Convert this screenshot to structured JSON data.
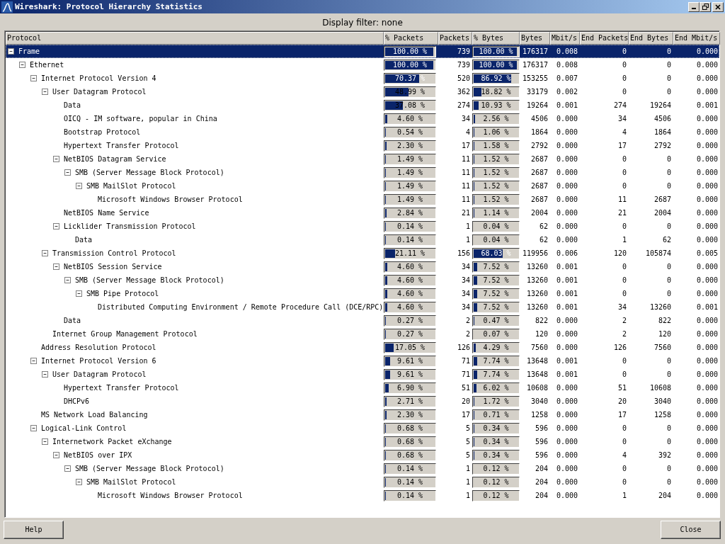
{
  "window": {
    "title": "Wireshark: Protocol Hierarchy Statistics"
  },
  "display_filter": "Display filter: none",
  "table": {
    "columns": [
      "Protocol",
      "% Packets",
      "Packets",
      "% Bytes",
      "Bytes",
      "Mbit/s",
      "End Packets",
      "End Bytes",
      "End Mbit/s"
    ],
    "rows": [
      {
        "protocol": "Frame",
        "pct_packets": {
          "text": "100.00 %",
          "level": 1
        },
        "packets": "739",
        "pct_bytes": {
          "text": "100.00 %",
          "level": 1
        },
        "bytes": "176317",
        "mbit_s": "0.008",
        "end_packets": "0",
        "end_bytes": "0",
        "end_mbit_s": "0.000",
        "selected": true,
        "expanded": true,
        "children": [
          {
            "protocol": "Ethernet",
            "pct_packets": {
              "text": "100.00 %",
              "level": 1
            },
            "packets": "739",
            "pct_bytes": {
              "text": "100.00 %",
              "level": 1
            },
            "bytes": "176317",
            "mbit_s": "0.008",
            "end_packets": "0",
            "end_bytes": "0",
            "end_mbit_s": "0.000",
            "selected": false,
            "expanded": true,
            "children": [
              {
                "protocol": "Internet Protocol Version 4",
                "pct_packets": {
                  "text": "70.37 %",
                  "level": 0.7037
                },
                "packets": "520",
                "pct_bytes": {
                  "text": "86.92 %",
                  "level": 0.8692
                },
                "bytes": "153255",
                "mbit_s": "0.007",
                "end_packets": "0",
                "end_bytes": "0",
                "end_mbit_s": "0.000",
                "selected": false,
                "expanded": true,
                "children": [
                  {
                    "protocol": "User Datagram Protocol",
                    "pct_packets": {
                      "text": "48.99 %",
                      "level": 0.4899
                    },
                    "packets": "362",
                    "pct_bytes": {
                      "text": "18.82 %",
                      "level": 0.1882
                    },
                    "bytes": "33179",
                    "mbit_s": "0.002",
                    "end_packets": "0",
                    "end_bytes": "0",
                    "end_mbit_s": "0.000",
                    "selected": false,
                    "expanded": true,
                    "children": [
                      {
                        "protocol": "Data",
                        "pct_packets": {
                          "text": "37.08 %",
                          "level": 0.3708
                        },
                        "packets": "274",
                        "pct_bytes": {
                          "text": "10.93 %",
                          "level": 0.1093
                        },
                        "bytes": "19264",
                        "mbit_s": "0.001",
                        "end_packets": "274",
                        "end_bytes": "19264",
                        "end_mbit_s": "0.001",
                        "selected": false
                      },
                      {
                        "protocol": "OICQ - IM software, popular in China",
                        "pct_packets": {
                          "text": "4.60 %",
                          "level": 0.046
                        },
                        "packets": "34",
                        "pct_bytes": {
                          "text": "2.56 %",
                          "level": 0.0256
                        },
                        "bytes": "4506",
                        "mbit_s": "0.000",
                        "end_packets": "34",
                        "end_bytes": "4506",
                        "end_mbit_s": "0.000",
                        "selected": false
                      },
                      {
                        "protocol": "Bootstrap Protocol",
                        "pct_packets": {
                          "text": "0.54 %",
                          "level": 0.0054
                        },
                        "packets": "4",
                        "pct_bytes": {
                          "text": "1.06 %",
                          "level": 0.0106
                        },
                        "bytes": "1864",
                        "mbit_s": "0.000",
                        "end_packets": "4",
                        "end_bytes": "1864",
                        "end_mbit_s": "0.000",
                        "selected": false
                      },
                      {
                        "protocol": "Hypertext Transfer Protocol",
                        "pct_packets": {
                          "text": "2.30 %",
                          "level": 0.023
                        },
                        "packets": "17",
                        "pct_bytes": {
                          "text": "1.58 %",
                          "level": 0.0158
                        },
                        "bytes": "2792",
                        "mbit_s": "0.000",
                        "end_packets": "17",
                        "end_bytes": "2792",
                        "end_mbit_s": "0.000",
                        "selected": false
                      },
                      {
                        "protocol": "NetBIOS Datagram Service",
                        "pct_packets": {
                          "text": "1.49 %",
                          "level": 0.0149
                        },
                        "packets": "11",
                        "pct_bytes": {
                          "text": "1.52 %",
                          "level": 0.0152
                        },
                        "bytes": "2687",
                        "mbit_s": "0.000",
                        "end_packets": "0",
                        "end_bytes": "0",
                        "end_mbit_s": "0.000",
                        "selected": false,
                        "expanded": true,
                        "children": [
                          {
                            "protocol": "SMB (Server Message Block Protocol)",
                            "pct_packets": {
                              "text": "1.49 %",
                              "level": 0.0149
                            },
                            "packets": "11",
                            "pct_bytes": {
                              "text": "1.52 %",
                              "level": 0.0152
                            },
                            "bytes": "2687",
                            "mbit_s": "0.000",
                            "end_packets": "0",
                            "end_bytes": "0",
                            "end_mbit_s": "0.000",
                            "selected": false,
                            "expanded": true,
                            "children": [
                              {
                                "protocol": "SMB MailSlot Protocol",
                                "pct_packets": {
                                  "text": "1.49 %",
                                  "level": 0.0149
                                },
                                "packets": "11",
                                "pct_bytes": {
                                  "text": "1.52 %",
                                  "level": 0.0152
                                },
                                "bytes": "2687",
                                "mbit_s": "0.000",
                                "end_packets": "0",
                                "end_bytes": "0",
                                "end_mbit_s": "0.000",
                                "selected": false,
                                "expanded": true,
                                "children": [
                                  {
                                    "protocol": "Microsoft Windows Browser Protocol",
                                    "pct_packets": {
                                      "text": "1.49 %",
                                      "level": 0.0149
                                    },
                                    "packets": "11",
                                    "pct_bytes": {
                                      "text": "1.52 %",
                                      "level": 0.0152
                                    },
                                    "bytes": "2687",
                                    "mbit_s": "0.000",
                                    "end_packets": "11",
                                    "end_bytes": "2687",
                                    "end_mbit_s": "0.000",
                                    "selected": false
                                  }
                                ]
                              }
                            ]
                          }
                        ]
                      },
                      {
                        "protocol": "NetBIOS Name Service",
                        "pct_packets": {
                          "text": "2.84 %",
                          "level": 0.0284
                        },
                        "packets": "21",
                        "pct_bytes": {
                          "text": "1.14 %",
                          "level": 0.0114
                        },
                        "bytes": "2004",
                        "mbit_s": "0.000",
                        "end_packets": "21",
                        "end_bytes": "2004",
                        "end_mbit_s": "0.000",
                        "selected": false
                      },
                      {
                        "protocol": "Licklider Transmission Protocol",
                        "pct_packets": {
                          "text": "0.14 %",
                          "level": 0.0014
                        },
                        "packets": "1",
                        "pct_bytes": {
                          "text": "0.04 %",
                          "level": 0.0004
                        },
                        "bytes": "62",
                        "mbit_s": "0.000",
                        "end_packets": "0",
                        "end_bytes": "0",
                        "end_mbit_s": "0.000",
                        "selected": false,
                        "expanded": true,
                        "children": [
                          {
                            "protocol": "Data",
                            "pct_packets": {
                              "text": "0.14 %",
                              "level": 0.0014
                            },
                            "packets": "1",
                            "pct_bytes": {
                              "text": "0.04 %",
                              "level": 0.0004
                            },
                            "bytes": "62",
                            "mbit_s": "0.000",
                            "end_packets": "1",
                            "end_bytes": "62",
                            "end_mbit_s": "0.000",
                            "selected": false
                          }
                        ]
                      }
                    ]
                  },
                  {
                    "protocol": "Transmission Control Protocol",
                    "pct_packets": {
                      "text": "21.11 %",
                      "level": 0.2111
                    },
                    "packets": "156",
                    "pct_bytes": {
                      "text": "68.03 %",
                      "level": 0.6803
                    },
                    "bytes": "119956",
                    "mbit_s": "0.006",
                    "end_packets": "120",
                    "end_bytes": "105874",
                    "end_mbit_s": "0.005",
                    "selected": false,
                    "expanded": true,
                    "children": [
                      {
                        "protocol": "NetBIOS Session Service",
                        "pct_packets": {
                          "text": "4.60 %",
                          "level": 0.046
                        },
                        "packets": "34",
                        "pct_bytes": {
                          "text": "7.52 %",
                          "level": 0.0752
                        },
                        "bytes": "13260",
                        "mbit_s": "0.001",
                        "end_packets": "0",
                        "end_bytes": "0",
                        "end_mbit_s": "0.000",
                        "selected": false,
                        "expanded": true,
                        "children": [
                          {
                            "protocol": "SMB (Server Message Block Protocol)",
                            "pct_packets": {
                              "text": "4.60 %",
                              "level": 0.046
                            },
                            "packets": "34",
                            "pct_bytes": {
                              "text": "7.52 %",
                              "level": 0.0752
                            },
                            "bytes": "13260",
                            "mbit_s": "0.001",
                            "end_packets": "0",
                            "end_bytes": "0",
                            "end_mbit_s": "0.000",
                            "selected": false,
                            "expanded": true,
                            "children": [
                              {
                                "protocol": "SMB Pipe Protocol",
                                "pct_packets": {
                                  "text": "4.60 %",
                                  "level": 0.046
                                },
                                "packets": "34",
                                "pct_bytes": {
                                  "text": "7.52 %",
                                  "level": 0.0752
                                },
                                "bytes": "13260",
                                "mbit_s": "0.001",
                                "end_packets": "0",
                                "end_bytes": "0",
                                "end_mbit_s": "0.000",
                                "selected": false,
                                "expanded": true,
                                "children": [
                                  {
                                    "protocol": "Distributed Computing Environment / Remote Procedure Call (DCE/RPC)",
                                    "pct_packets": {
                                      "text": "4.60 %",
                                      "level": 0.046
                                    },
                                    "packets": "34",
                                    "pct_bytes": {
                                      "text": "7.52 %",
                                      "level": 0.0752
                                    },
                                    "bytes": "13260",
                                    "mbit_s": "0.001",
                                    "end_packets": "34",
                                    "end_bytes": "13260",
                                    "end_mbit_s": "0.001",
                                    "selected": false
                                  }
                                ]
                              }
                            ]
                          }
                        ]
                      },
                      {
                        "protocol": "Data",
                        "pct_packets": {
                          "text": "0.27 %",
                          "level": 0.0027
                        },
                        "packets": "2",
                        "pct_bytes": {
                          "text": "0.47 %",
                          "level": 0.0047
                        },
                        "bytes": "822",
                        "mbit_s": "0.000",
                        "end_packets": "2",
                        "end_bytes": "822",
                        "end_mbit_s": "0.000",
                        "selected": false
                      }
                    ]
                  },
                  {
                    "protocol": "Internet Group Management Protocol",
                    "pct_packets": {
                      "text": "0.27 %",
                      "level": 0.0027
                    },
                    "packets": "2",
                    "pct_bytes": {
                      "text": "0.07 %",
                      "level": 0.0007
                    },
                    "bytes": "120",
                    "mbit_s": "0.000",
                    "end_packets": "2",
                    "end_bytes": "120",
                    "end_mbit_s": "0.000",
                    "selected": false
                  }
                ]
              },
              {
                "protocol": "Address Resolution Protocol",
                "pct_packets": {
                  "text": "17.05 %",
                  "level": 0.1705
                },
                "packets": "126",
                "pct_bytes": {
                  "text": "4.29 %",
                  "level": 0.0429
                },
                "bytes": "7560",
                "mbit_s": "0.000",
                "end_packets": "126",
                "end_bytes": "7560",
                "end_mbit_s": "0.000",
                "selected": false
              },
              {
                "protocol": "Internet Protocol Version 6",
                "pct_packets": {
                  "text": "9.61 %",
                  "level": 0.0961
                },
                "packets": "71",
                "pct_bytes": {
                  "text": "7.74 %",
                  "level": 0.0774
                },
                "bytes": "13648",
                "mbit_s": "0.001",
                "end_packets": "0",
                "end_bytes": "0",
                "end_mbit_s": "0.000",
                "selected": false,
                "expanded": true,
                "children": [
                  {
                    "protocol": "User Datagram Protocol",
                    "pct_packets": {
                      "text": "9.61 %",
                      "level": 0.0961
                    },
                    "packets": "71",
                    "pct_bytes": {
                      "text": "7.74 %",
                      "level": 0.0774
                    },
                    "bytes": "13648",
                    "mbit_s": "0.001",
                    "end_packets": "0",
                    "end_bytes": "0",
                    "end_mbit_s": "0.000",
                    "selected": false,
                    "expanded": true,
                    "children": [
                      {
                        "protocol": "Hypertext Transfer Protocol",
                        "pct_packets": {
                          "text": "6.90 %",
                          "level": 0.069
                        },
                        "packets": "51",
                        "pct_bytes": {
                          "text": "6.02 %",
                          "level": 0.0602
                        },
                        "bytes": "10608",
                        "mbit_s": "0.000",
                        "end_packets": "51",
                        "end_bytes": "10608",
                        "end_mbit_s": "0.000",
                        "selected": false
                      },
                      {
                        "protocol": "DHCPv6",
                        "pct_packets": {
                          "text": "2.71 %",
                          "level": 0.0271
                        },
                        "packets": "20",
                        "pct_bytes": {
                          "text": "1.72 %",
                          "level": 0.0172
                        },
                        "bytes": "3040",
                        "mbit_s": "0.000",
                        "end_packets": "20",
                        "end_bytes": "3040",
                        "end_mbit_s": "0.000",
                        "selected": false
                      }
                    ]
                  }
                ]
              },
              {
                "protocol": "MS Network Load Balancing",
                "pct_packets": {
                  "text": "2.30 %",
                  "level": 0.023
                },
                "packets": "17",
                "pct_bytes": {
                  "text": "0.71 %",
                  "level": 0.0071
                },
                "bytes": "1258",
                "mbit_s": "0.000",
                "end_packets": "17",
                "end_bytes": "1258",
                "end_mbit_s": "0.000",
                "selected": false
              },
              {
                "protocol": "Logical-Link Control",
                "pct_packets": {
                  "text": "0.68 %",
                  "level": 0.0068
                },
                "packets": "5",
                "pct_bytes": {
                  "text": "0.34 %",
                  "level": 0.0034
                },
                "bytes": "596",
                "mbit_s": "0.000",
                "end_packets": "0",
                "end_bytes": "0",
                "end_mbit_s": "0.000",
                "selected": false,
                "expanded": true,
                "children": [
                  {
                    "protocol": "Internetwork Packet eXchange",
                    "pct_packets": {
                      "text": "0.68 %",
                      "level": 0.0068
                    },
                    "packets": "5",
                    "pct_bytes": {
                      "text": "0.34 %",
                      "level": 0.0034
                    },
                    "bytes": "596",
                    "mbit_s": "0.000",
                    "end_packets": "0",
                    "end_bytes": "0",
                    "end_mbit_s": "0.000",
                    "selected": false,
                    "expanded": true,
                    "children": [
                      {
                        "protocol": "NetBIOS over IPX",
                        "pct_packets": {
                          "text": "0.68 %",
                          "level": 0.0068
                        },
                        "packets": "5",
                        "pct_bytes": {
                          "text": "0.34 %",
                          "level": 0.0034
                        },
                        "bytes": "596",
                        "mbit_s": "0.000",
                        "end_packets": "4",
                        "end_bytes": "392",
                        "end_mbit_s": "0.000",
                        "selected": false,
                        "expanded": true,
                        "children": [
                          {
                            "protocol": "SMB (Server Message Block Protocol)",
                            "pct_packets": {
                              "text": "0.14 %",
                              "level": 0.0014
                            },
                            "packets": "1",
                            "pct_bytes": {
                              "text": "0.12 %",
                              "level": 0.0012
                            },
                            "bytes": "204",
                            "mbit_s": "0.000",
                            "end_packets": "0",
                            "end_bytes": "0",
                            "end_mbit_s": "0.000",
                            "selected": false,
                            "expanded": true,
                            "children": [
                              {
                                "protocol": "SMB MailSlot Protocol",
                                "pct_packets": {
                                  "text": "0.14 %",
                                  "level": 0.0014
                                },
                                "packets": "1",
                                "pct_bytes": {
                                  "text": "0.12 %",
                                  "level": 0.0012
                                },
                                "bytes": "204",
                                "mbit_s": "0.000",
                                "end_packets": "0",
                                "end_bytes": "0",
                                "end_mbit_s": "0.000",
                                "selected": false,
                                "expanded": true,
                                "children": [
                                  {
                                    "protocol": "Microsoft Windows Browser Protocol",
                                    "pct_packets": {
                                      "text": "0.14 %",
                                      "level": 0.0014
                                    },
                                    "packets": "1",
                                    "pct_bytes": {
                                      "text": "0.12 %",
                                      "level": 0.0012
                                    },
                                    "bytes": "204",
                                    "mbit_s": "0.000",
                                    "end_packets": "1",
                                    "end_bytes": "204",
                                    "end_mbit_s": "0.000",
                                    "selected": false
                                  }
                                ]
                              }
                            ]
                          }
                        ]
                      }
                    ]
                  }
                ]
              }
            ]
          }
        ]
      }
    ]
  },
  "buttons": [
    "Help",
    "Close"
  ]
}
